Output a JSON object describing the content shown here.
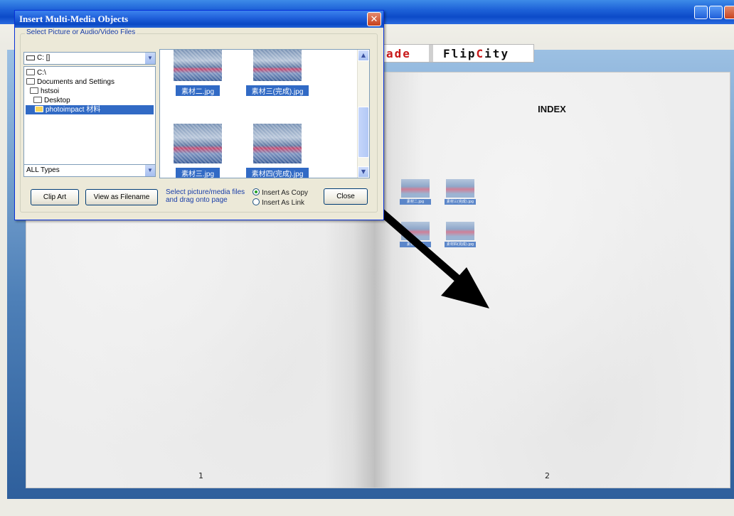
{
  "dialog": {
    "title": "Insert Multi-Media Objects",
    "close_glyph": "✕",
    "group_label": "Select Picture or Audio/Video Files",
    "drive": "C: []",
    "folders": [
      {
        "label": "C:\\"
      },
      {
        "label": "Documents and Settings"
      },
      {
        "label": "hstsoi"
      },
      {
        "label": "Desktop"
      },
      {
        "label": "photoimpact 材料",
        "selected": true
      }
    ],
    "file_type": "ALL Types",
    "files": [
      {
        "name": "素材二.jpg"
      },
      {
        "name": "素材三(完成).jpg"
      },
      {
        "name": "素材三.jpg"
      },
      {
        "name": "素材四(完成).jpg"
      }
    ],
    "buttons": {
      "clip_art": "Clip Art",
      "view_as_filename": "View as Filename",
      "close": "Close"
    },
    "hint_line1": "Select picture/media files",
    "hint_line2": "and drag onto page",
    "options": {
      "insert_as_copy": "Insert As Copy",
      "insert_as_link": "Insert As Link",
      "selected": "insert_as_copy"
    }
  },
  "banner": {
    "part_a": "ade",
    "part_b_prefix": "Flip",
    "part_b_highlight": "C",
    "part_b_suffix": "ity"
  },
  "book": {
    "index_title": "INDEX",
    "left_page_number": "1",
    "right_page_number": "2",
    "thumb_captions": [
      "素材二.jpg",
      "素材三(完成).jpg",
      "素材三.jpg",
      "素材四(完成).jpg"
    ]
  },
  "icons": {
    "drive_icon": "drive-icon",
    "folder_icon": "folder-icon",
    "dropdown_icon": "chevron-down-icon",
    "arrow_icon": "drag-arrow-icon"
  }
}
